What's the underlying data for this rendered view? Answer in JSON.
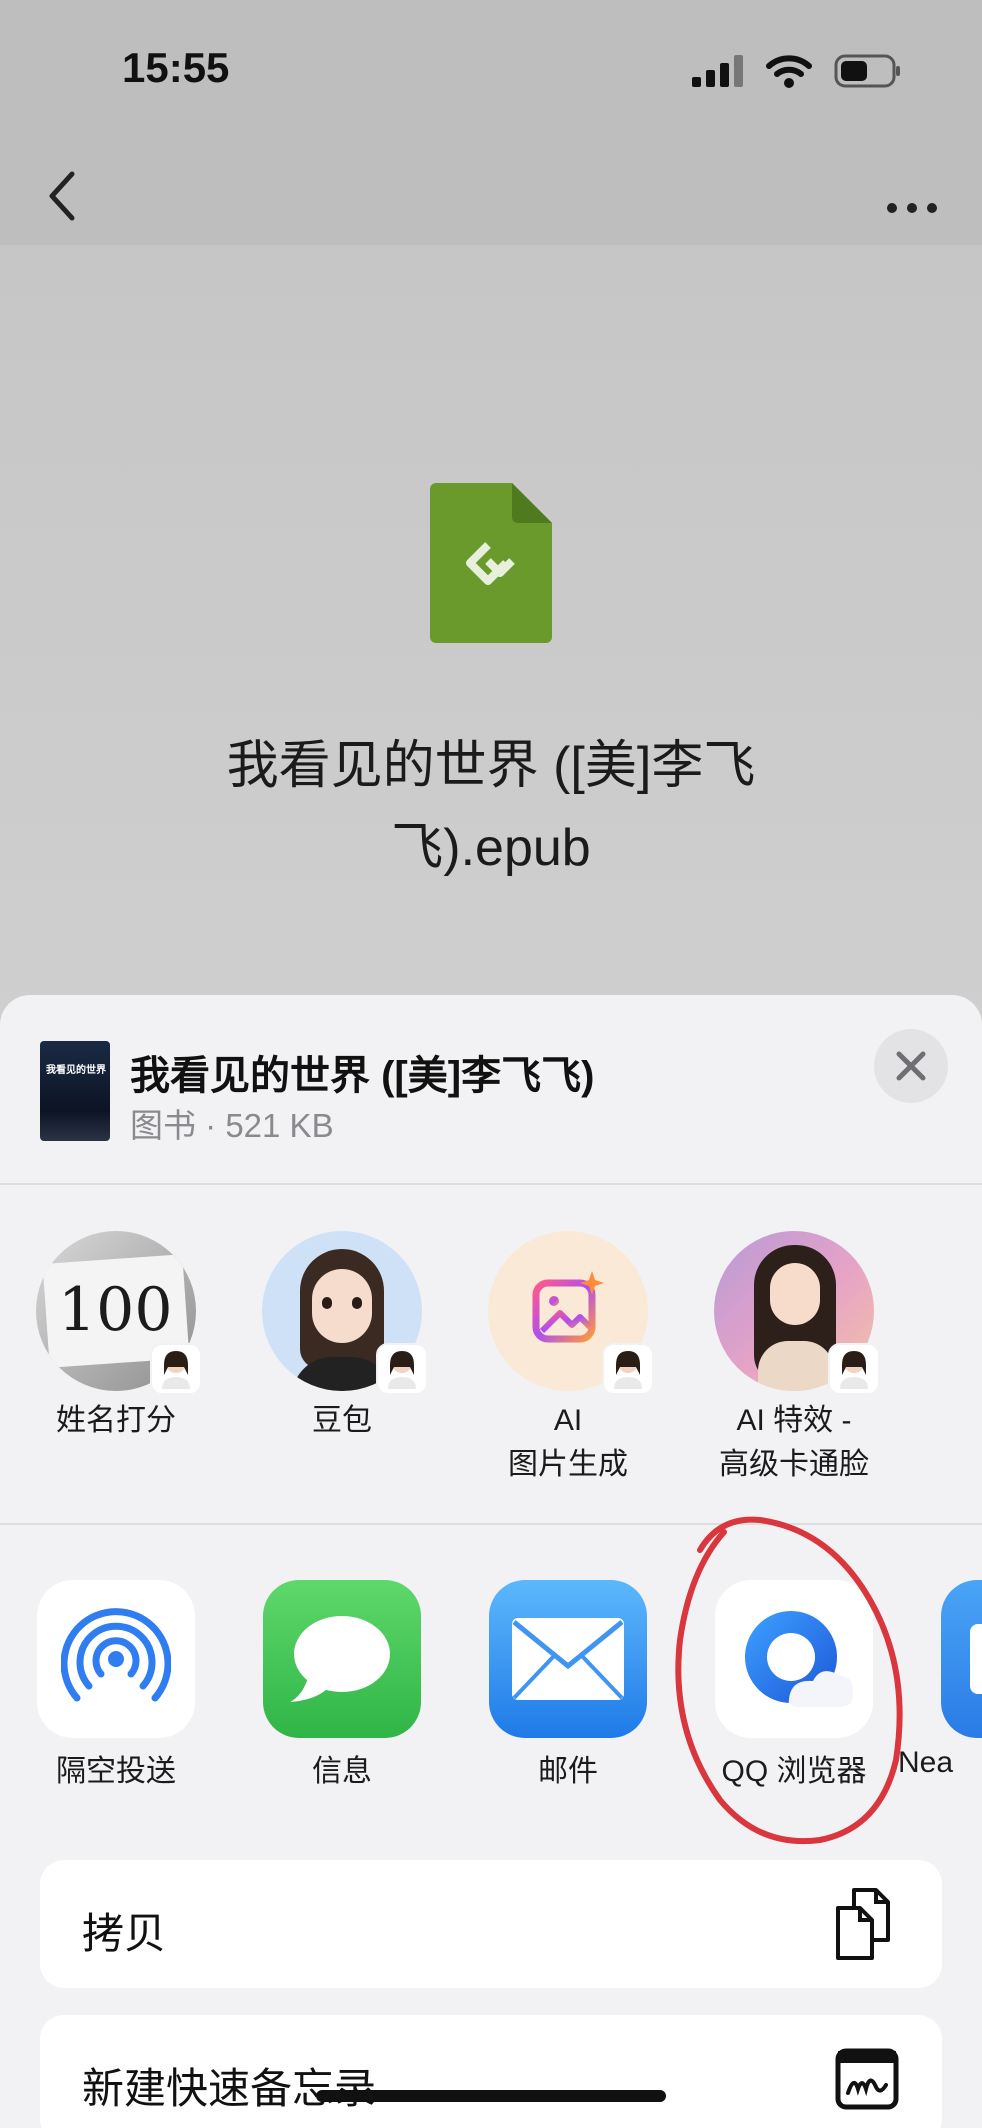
{
  "status_bar": {
    "time": "15:55"
  },
  "nav": {
    "back_icon": "chevron-left-icon",
    "more_icon": "ellipsis-icon"
  },
  "document": {
    "file_type_icon": "epub-file-icon",
    "icon_color": "#6b9a2c",
    "title_line1": "我看见的世界 ([美]李飞",
    "title_line2": "飞).epub"
  },
  "share_sheet": {
    "title": "我看见的世界 ([美]李飞飞)",
    "subtitle": "图书 · 521 KB",
    "cover_title": "我看见的世界",
    "close_icon": "close-icon",
    "contacts": [
      {
        "name": "姓名打分",
        "avatar_text": "100"
      },
      {
        "name": "豆包"
      },
      {
        "name": "AI\n图片生成"
      },
      {
        "name": "AI 特效 -\n高级卡通脸"
      }
    ],
    "apps": [
      {
        "label": "隔空投送",
        "icon": "airdrop-icon"
      },
      {
        "label": "信息",
        "icon": "messages-icon",
        "color": "#3fc35a"
      },
      {
        "label": "邮件",
        "icon": "mail-icon",
        "color": "#2f8bf0"
      },
      {
        "label": "QQ 浏览器",
        "icon": "qq-browser-icon",
        "color": "#2a7cf2"
      },
      {
        "label": "Nea",
        "icon": "app-icon"
      }
    ],
    "annotation_color": "#d9363e",
    "actions": [
      {
        "label": "拷贝",
        "icon": "copy-icon"
      },
      {
        "label": "新建快速备忘录",
        "icon": "quick-note-icon"
      }
    ]
  }
}
